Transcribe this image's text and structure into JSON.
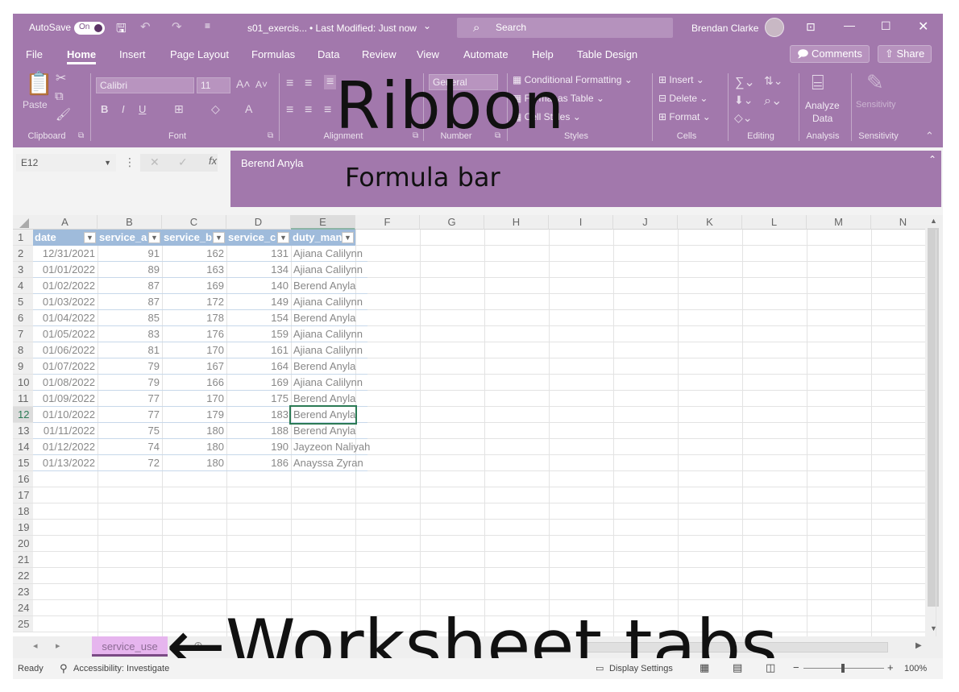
{
  "titlebar": {
    "autosave_label": "AutoSave",
    "autosave_state": "On",
    "filename": "s01_exercis...",
    "modified": "• Last Modified: Just now",
    "search_label": "Search",
    "user": "Brendan Clarke"
  },
  "tabs": [
    "File",
    "Home",
    "Insert",
    "Page Layout",
    "Formulas",
    "Data",
    "Review",
    "View",
    "Automate",
    "Help",
    "Table Design"
  ],
  "active_tab": "Home",
  "tab_buttons": {
    "comments": "Comments",
    "share": "Share"
  },
  "ribbon": {
    "font_name": "Calibri",
    "font_size": "11",
    "number_format": "General",
    "paste": "Paste",
    "cond_format": "Conditional Formatting",
    "format_table": "Format as Table",
    "cell_styles": "Cell Styles",
    "insert": "Insert",
    "delete": "Delete",
    "format": "Format",
    "analyze": "Analyze",
    "analyze2": "Data",
    "sensitivity": "Sensitivity",
    "groups": [
      "Clipboard",
      "Font",
      "Alignment",
      "Number",
      "Styles",
      "Cells",
      "Editing",
      "Analysis",
      "Sensitivity"
    ]
  },
  "overlays": {
    "ribbon": "Ribbon",
    "formula_bar": "Formula bar",
    "worksheet_tabs": "←Worksheet tabs"
  },
  "formula": {
    "namebox": "E12",
    "content": "Berend Anyla"
  },
  "columns": [
    "A",
    "B",
    "C",
    "D",
    "E",
    "F",
    "G",
    "H",
    "I",
    "J",
    "K",
    "L",
    "M",
    "N"
  ],
  "table_headers": [
    "date",
    "service_a",
    "service_b",
    "service_c",
    "duty_man"
  ],
  "rows": [
    [
      "12/31/2021",
      "91",
      "162",
      "131",
      "Ajiana Calilynn"
    ],
    [
      "01/01/2022",
      "89",
      "163",
      "134",
      "Ajiana Calilynn"
    ],
    [
      "01/02/2022",
      "87",
      "169",
      "140",
      "Berend Anyla"
    ],
    [
      "01/03/2022",
      "87",
      "172",
      "149",
      "Ajiana Calilynn"
    ],
    [
      "01/04/2022",
      "85",
      "178",
      "154",
      "Berend Anyla"
    ],
    [
      "01/05/2022",
      "83",
      "176",
      "159",
      "Ajiana Calilynn"
    ],
    [
      "01/06/2022",
      "81",
      "170",
      "161",
      "Ajiana Calilynn"
    ],
    [
      "01/07/2022",
      "79",
      "167",
      "164",
      "Berend Anyla"
    ],
    [
      "01/08/2022",
      "79",
      "166",
      "169",
      "Ajiana Calilynn"
    ],
    [
      "01/09/2022",
      "77",
      "170",
      "175",
      "Berend Anyla"
    ],
    [
      "01/10/2022",
      "77",
      "179",
      "183",
      "Berend Anyla"
    ],
    [
      "01/11/2022",
      "75",
      "180",
      "188",
      "Berend Anyla"
    ],
    [
      "01/12/2022",
      "74",
      "180",
      "190",
      "Jayzeon Naliyah"
    ],
    [
      "01/13/2022",
      "72",
      "180",
      "186",
      "Anayssa Zyran"
    ]
  ],
  "row_numbers": [
    "1",
    "2",
    "3",
    "4",
    "5",
    "6",
    "7",
    "8",
    "9",
    "10",
    "11",
    "12",
    "13",
    "14",
    "15",
    "16",
    "17",
    "18",
    "19",
    "20",
    "21",
    "22",
    "23",
    "24",
    "25"
  ],
  "sheet_tab": "service_use",
  "statusbar": {
    "ready": "Ready",
    "accessibility": "Accessibility: Investigate",
    "display": "Display Settings",
    "zoom": "100%"
  }
}
